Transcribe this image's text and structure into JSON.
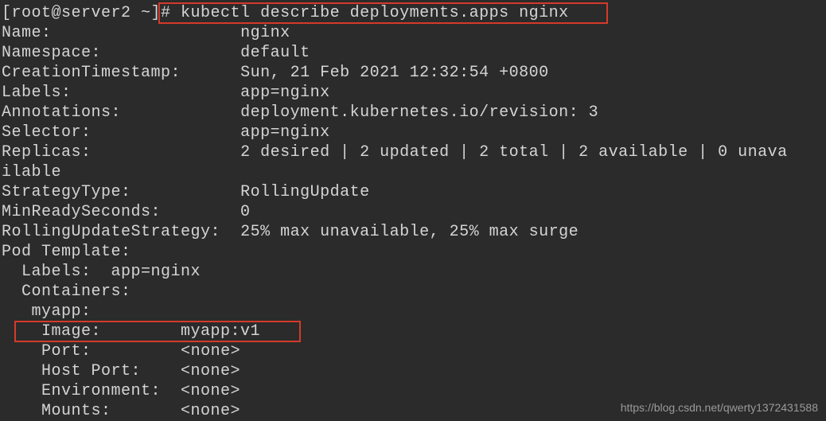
{
  "prompt": "[root@server2 ~]# ",
  "command": "kubectl describe deployments.apps nginx",
  "fields": {
    "name_label": "Name:",
    "name_value": "nginx",
    "namespace_label": "Namespace:",
    "namespace_value": "default",
    "creation_label": "CreationTimestamp:",
    "creation_value": "Sun, 21 Feb 2021 12:32:54 +0800",
    "labels_label": "Labels:",
    "labels_value": "app=nginx",
    "annotations_label": "Annotations:",
    "annotations_value": "deployment.kubernetes.io/revision: 3",
    "selector_label": "Selector:",
    "selector_value": "app=nginx",
    "replicas_label": "Replicas:",
    "replicas_value": "2 desired | 2 updated | 2 total | 2 available | 0 unava",
    "replicas_wrap": "ilable",
    "strategy_label": "StrategyType:",
    "strategy_value": "RollingUpdate",
    "minready_label": "MinReadySeconds:",
    "minready_value": "0",
    "rolling_label": "RollingUpdateStrategy:",
    "rolling_value": "25% max unavailable, 25% max surge",
    "pod_template_label": "Pod Template:",
    "pod_labels_label": "  Labels:  ",
    "pod_labels_value": "app=nginx",
    "containers_label": "  Containers:",
    "container_name": "   myapp:",
    "image_label": "    Image:",
    "image_value": "myapp:v1",
    "port_label": "    Port:",
    "port_value": "<none>",
    "hostport_label": "    Host Port:",
    "hostport_value": "<none>",
    "env_label": "    Environment:",
    "env_value": "<none>",
    "mounts_label": "    Mounts:",
    "mounts_value": "<none>"
  },
  "watermark": "https://blog.csdn.net/qwerty1372431588"
}
